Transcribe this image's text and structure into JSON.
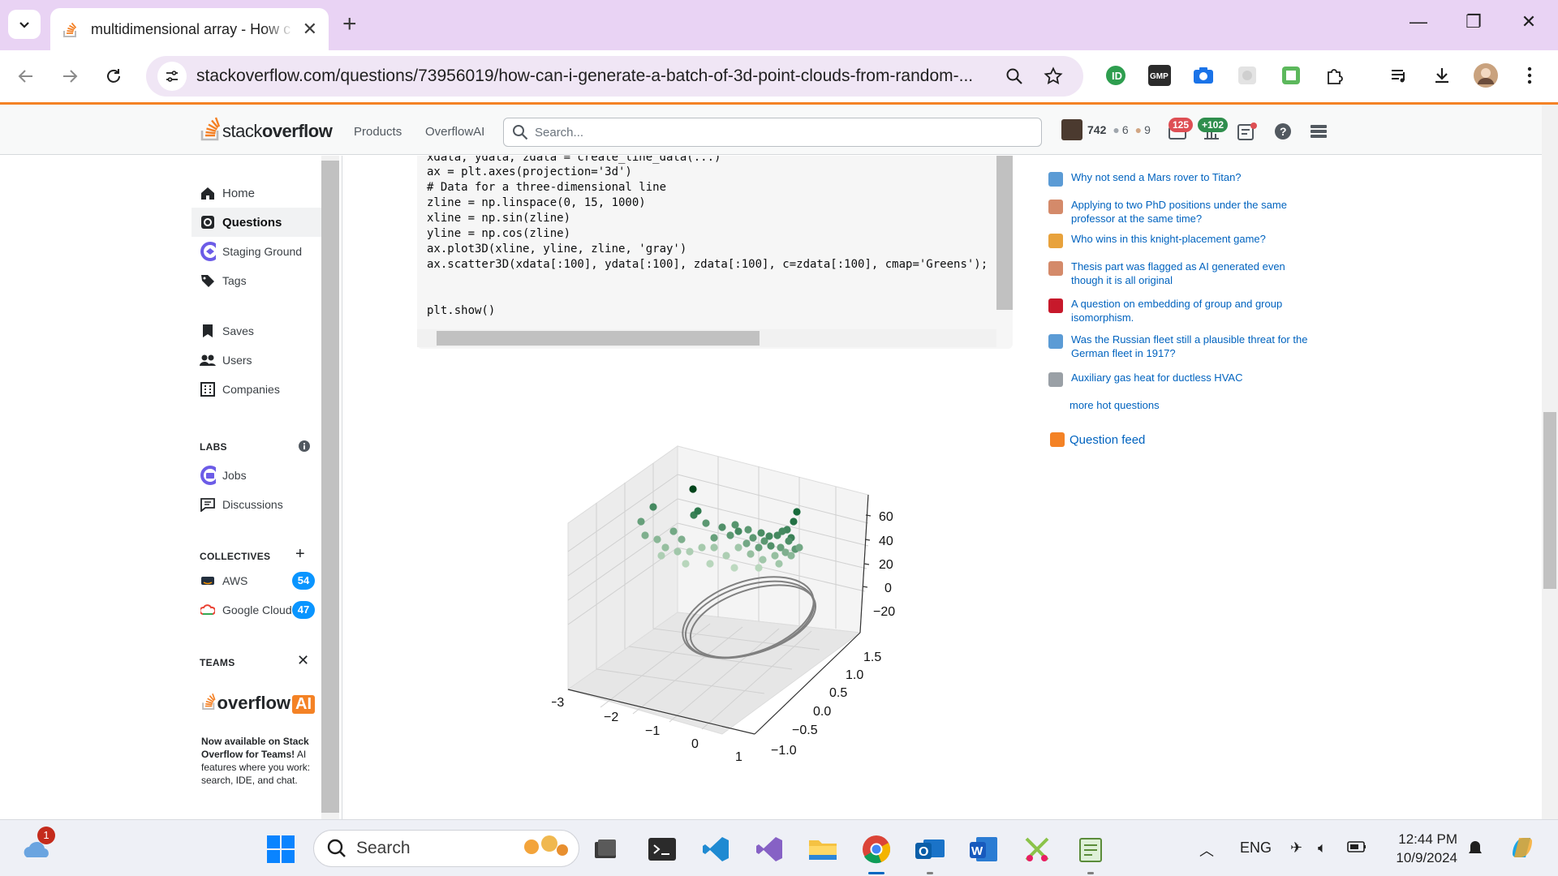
{
  "browser": {
    "tab_title": "multidimensional array - How c",
    "url": "stackoverflow.com/questions/73956019/how-can-i-generate-a-batch-of-3d-point-clouds-from-random-..."
  },
  "so_header": {
    "logo_text_light": "stack",
    "logo_text_bold": "overflow",
    "nav": [
      "Products",
      "OverflowAI"
    ],
    "search_placeholder": "Search...",
    "reputation": "742",
    "silver": "6",
    "bronze": "9",
    "inbox_count": "125",
    "rep_change": "+102"
  },
  "sidebar": {
    "items": [
      {
        "label": "Home",
        "icon": "home-icon"
      },
      {
        "label": "Questions",
        "icon": "questions-icon"
      },
      {
        "label": "Staging Ground",
        "icon": "staging-icon"
      },
      {
        "label": "Tags",
        "icon": "tag-icon"
      },
      {
        "label": "Saves",
        "icon": "bookmark-icon"
      },
      {
        "label": "Users",
        "icon": "users-icon"
      },
      {
        "label": "Companies",
        "icon": "companies-icon"
      }
    ],
    "labs_heading": "LABS",
    "labs": [
      {
        "label": "Jobs",
        "icon": "jobs-icon"
      },
      {
        "label": "Discussions",
        "icon": "discussions-icon"
      }
    ],
    "collectives_heading": "COLLECTIVES",
    "collectives": [
      {
        "label": "AWS",
        "count": "54"
      },
      {
        "label": "Google Cloud",
        "count": "47"
      }
    ],
    "teams_heading": "TEAMS",
    "promo": {
      "logo_text": "overflow",
      "logo_badge": "AI",
      "bold": "Now available on Stack Overflow for Teams!",
      "rest": " AI features where you work: search, IDE, and chat."
    }
  },
  "code": {
    "lines": [
      "xdata, ydata, zdata = create_line_data(...)",
      "ax = plt.axes(projection='3d')",
      "# Data for a three-dimensional line",
      "zline = np.linspace(0, 15, 1000)",
      "xline = np.sin(zline)",
      "yline = np.cos(zline)",
      "ax.plot3D(xline, yline, zline, 'gray')",
      "ax.scatter3D(xdata[:100], ydata[:100], zdata[:100], c=zdata[:100], cmap='Greens');",
      "",
      "",
      "plt.show()"
    ]
  },
  "chart_data": {
    "type": "scatter",
    "title": "",
    "z_ticks": [
      "60",
      "40",
      "20",
      "0",
      "−20"
    ],
    "y_ticks": [
      "1.5",
      "1.0",
      "0.5",
      "0.0",
      "−0.5",
      "−1.0"
    ],
    "x_ticks": [
      "−3",
      "−2",
      "−1",
      "0",
      "1"
    ],
    "cmap": "Greens",
    "line_color": "gray"
  },
  "hot_questions": {
    "items": [
      {
        "title": "Why not send a Mars rover to Titan?",
        "color": "#5b9bd5"
      },
      {
        "title": "Applying to two PhD positions under the same professor at the same time?",
        "color": "#d48a6a"
      },
      {
        "title": "Who wins in this knight-placement game?",
        "color": "#e8a23c"
      },
      {
        "title": "Thesis part was flagged as AI generated even though it is all original",
        "color": "#d48a6a"
      },
      {
        "title": "A question on embedding of group and group isomorphism.",
        "color": "#c7192b"
      },
      {
        "title": "Was the Russian fleet still a plausible threat for the German fleet in 1917?",
        "color": "#5b9bd5"
      },
      {
        "title": "Auxiliary gas heat for ductless HVAC",
        "color": "#9aa0a6"
      }
    ],
    "more": "more hot questions",
    "feed": "Question feed"
  },
  "taskbar": {
    "search": "Search",
    "weather_badge": "1",
    "lang": "ENG",
    "time": "12:44 PM",
    "date": "10/9/2024"
  }
}
